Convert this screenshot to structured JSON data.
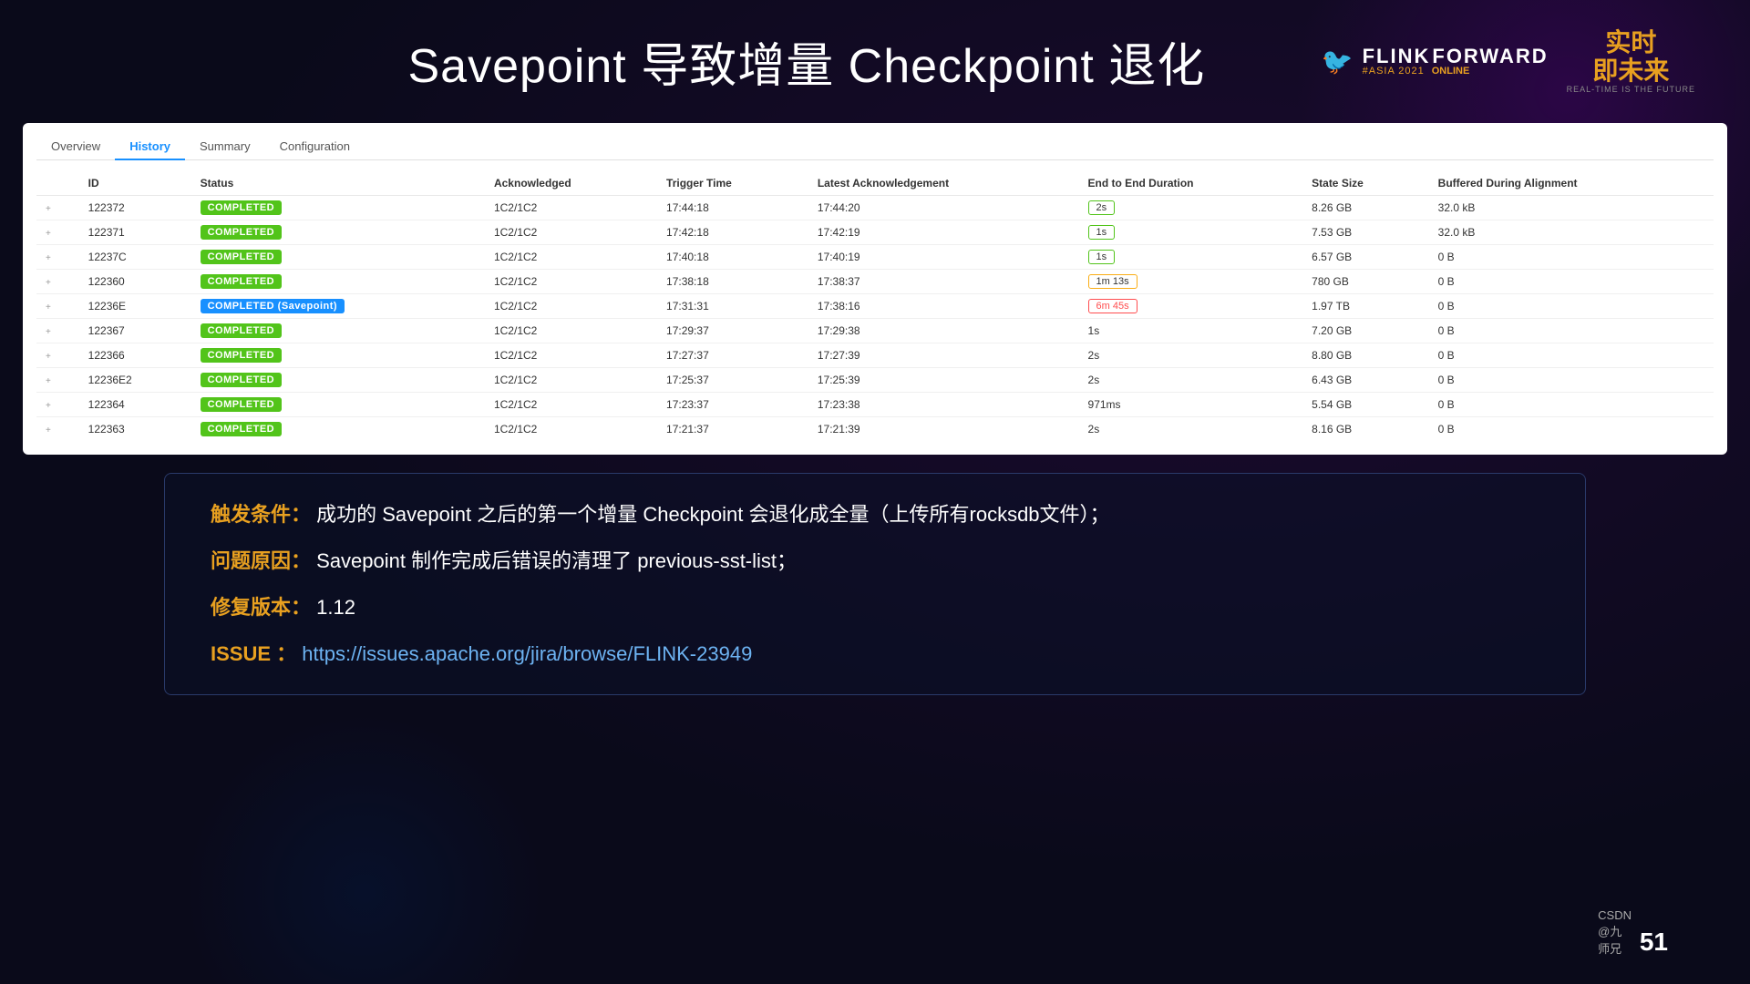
{
  "header": {
    "title": "Savepoint 导致增量 Checkpoint 退化",
    "logo": {
      "flink": "FLINK",
      "forward": "FORWARD",
      "hashtag": "#ASIA 2021",
      "online": "ONLINE",
      "chinese1": "实时",
      "chinese2": "即未来",
      "realtime_sub": "REAL-TIME IS THE FUTURE"
    },
    "slide_number": "51",
    "csdn": "CSDN @九师兄"
  },
  "tabs": [
    {
      "label": "Overview",
      "active": false
    },
    {
      "label": "History",
      "active": true
    },
    {
      "label": "Summary",
      "active": false
    },
    {
      "label": "Configuration",
      "active": false
    }
  ],
  "table": {
    "columns": [
      "ID",
      "Status",
      "Acknowledged",
      "Trigger Time",
      "Latest Acknowledgement",
      "End to End Duration",
      "State Size",
      "Buffered During Alignment"
    ],
    "rows": [
      {
        "expand": "+",
        "id": "122372",
        "status": "COMPLETED",
        "status_type": "normal",
        "acknowledged": "1C2/1C2",
        "trigger_time": "17:44:18",
        "latest_ack": "17:44:20",
        "duration": "2s",
        "duration_type": "green_box",
        "state_size": "8.26 GB",
        "buffered": "32.0 kB"
      },
      {
        "expand": "+",
        "id": "122371",
        "status": "COMPLETED",
        "status_type": "normal",
        "acknowledged": "1C2/1C2",
        "trigger_time": "17:42:18",
        "latest_ack": "17:42:19",
        "duration": "1s",
        "duration_type": "green_box",
        "state_size": "7.53 GB",
        "buffered": "32.0 kB"
      },
      {
        "expand": "+",
        "id": "12237C",
        "status": "COMPLETED",
        "status_type": "normal",
        "acknowledged": "1C2/1C2",
        "trigger_time": "17:40:18",
        "latest_ack": "17:40:19",
        "duration": "1s",
        "duration_type": "green_box",
        "state_size": "6.57 GB",
        "buffered": "0 B"
      },
      {
        "expand": "+",
        "id": "122360",
        "status": "COMPLETED",
        "status_type": "normal",
        "acknowledged": "1C2/1C2",
        "trigger_time": "17:38:18",
        "latest_ack": "17:38:37",
        "duration": "1m 13s",
        "duration_type": "yellow_box",
        "state_size": "780 GB",
        "buffered": "0 B"
      },
      {
        "expand": "+",
        "id": "12236E",
        "status": "COMPLETED (Savepoint)",
        "status_type": "savepoint",
        "acknowledged": "1C2/1C2",
        "trigger_time": "17:31:31",
        "latest_ack": "17:38:16",
        "duration": "6m 45s",
        "duration_type": "red_box",
        "state_size": "1.97 TB",
        "buffered": "0 B"
      },
      {
        "expand": "+",
        "id": "122367",
        "status": "COMPLETED",
        "status_type": "normal",
        "acknowledged": "1C2/1C2",
        "trigger_time": "17:29:37",
        "latest_ack": "17:29:38",
        "duration": "1s",
        "duration_type": "plain",
        "state_size": "7.20 GB",
        "buffered": "0 B"
      },
      {
        "expand": "+",
        "id": "122366",
        "status": "COMPLETED",
        "status_type": "normal",
        "acknowledged": "1C2/1C2",
        "trigger_time": "17:27:37",
        "latest_ack": "17:27:39",
        "duration": "2s",
        "duration_type": "plain",
        "state_size": "8.80 GB",
        "buffered": "0 B"
      },
      {
        "expand": "+",
        "id": "12236E2",
        "status": "COMPLETED",
        "status_type": "normal",
        "acknowledged": "1C2/1C2",
        "trigger_time": "17:25:37",
        "latest_ack": "17:25:39",
        "duration": "2s",
        "duration_type": "plain",
        "state_size": "6.43 GB",
        "buffered": "0 B"
      },
      {
        "expand": "+",
        "id": "122364",
        "status": "COMPLETED",
        "status_type": "normal",
        "acknowledged": "1C2/1C2",
        "trigger_time": "17:23:37",
        "latest_ack": "17:23:38",
        "duration": "971ms",
        "duration_type": "plain",
        "state_size": "5.54 GB",
        "buffered": "0 B"
      },
      {
        "expand": "+",
        "id": "122363",
        "status": "COMPLETED",
        "status_type": "normal",
        "acknowledged": "1C2/1C2",
        "trigger_time": "17:21:37",
        "latest_ack": "17:21:39",
        "duration": "2s",
        "duration_type": "plain",
        "state_size": "8.16 GB",
        "buffered": "0 B"
      }
    ]
  },
  "info_box": {
    "line1_label": "触发条件：",
    "line1_text": "成功的 Savepoint 之后的第一个增量 Checkpoint 会退化成全量（上传所有rocksdb文件）；",
    "line2_label": "问题原因：",
    "line2_text": "Savepoint 制作完成后错误的清理了 previous-sst-list；",
    "line3_label": "修复版本：",
    "line3_text": "1.12",
    "line4_label": "ISSUE  ：",
    "line4_link": "https://issues.apache.org/jira/browse/FLINK-23949",
    "line4_link_text": "https://issues.apache.org/jira/browse/FLINK-23949"
  }
}
